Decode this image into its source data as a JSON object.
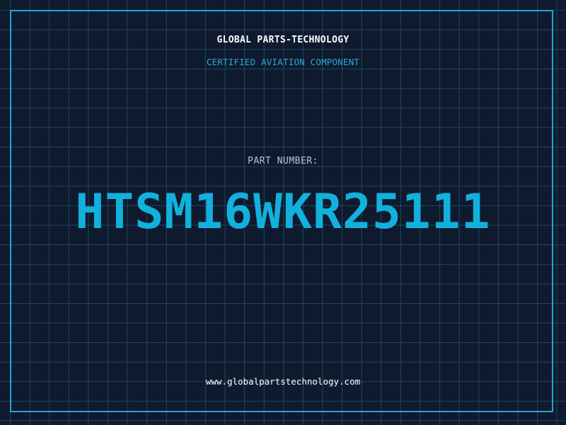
{
  "header": {
    "brand": "GLOBAL PARTS-TECHNOLOGY",
    "subtitle": "CERTIFIED AVIATION COMPONENT"
  },
  "part": {
    "label": "PART NUMBER:",
    "number": "HTSM16WKR25111"
  },
  "footer": {
    "url": "www.globalpartstechnology.com"
  },
  "colors": {
    "background": "#0f1a2e",
    "grid": "#236e8c",
    "accent": "#1fa8cf",
    "text": "#ffffff"
  }
}
